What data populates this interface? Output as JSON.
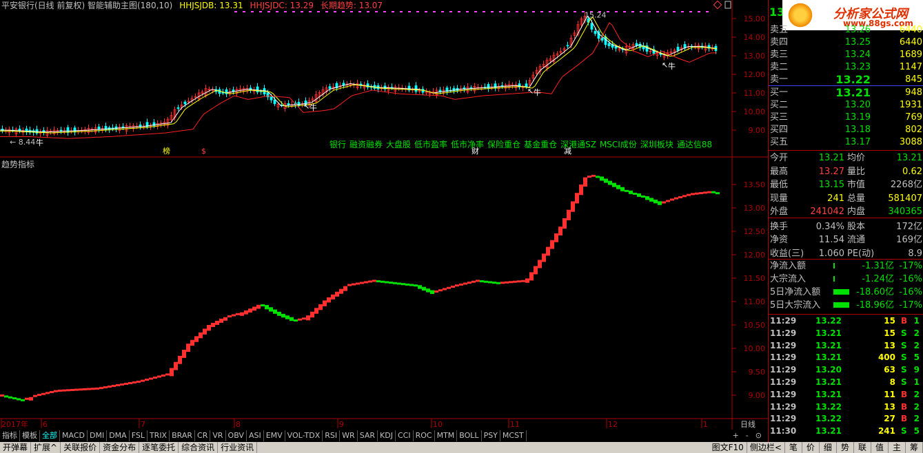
{
  "header": {
    "stock_title": "平安银行(日线 前复权) 智能辅助主图(180,10)",
    "hhjsjdb": "HHJSJDB: 13.31",
    "hhjsjdc": "HHJSJDC: 13.29",
    "long_trend": "长期趋势: 13.07",
    "high_label": "15.24",
    "low_label": "8.44"
  },
  "main_axis": [
    "15.00",
    "14.00",
    "13.00",
    "12.00",
    "11.00",
    "10.00",
    "9.00"
  ],
  "sub_axis": [
    "13.50",
    "13.00",
    "12.50",
    "12.00",
    "11.50",
    "11.00",
    "10.50",
    "10.00",
    "9.50",
    "9.00"
  ],
  "sub_title": "趋势指标",
  "tags": [
    "银行",
    "融资融券",
    "大盘股",
    "低市盈率",
    "低市净率",
    "保险重仓",
    "基金重仓",
    "深港通SZ",
    "MSCI成份",
    "深圳板块",
    "通达信88"
  ],
  "markers": {
    "bang": "榜",
    "dollar": "$",
    "cai": "财",
    "jian": "减",
    "niu": "牛"
  },
  "x_axis": [
    "2017年",
    "6",
    "7",
    "8",
    "9",
    "10",
    "11",
    "12",
    "1"
  ],
  "x_axis_label": "日线",
  "tabs": [
    "指标",
    "模板",
    "全部",
    "MACD",
    "DMI",
    "DMA",
    "FSL",
    "TRIX",
    "BRAR",
    "CR",
    "VR",
    "OBV",
    "ASI",
    "EMV",
    "VOL-TDX",
    "RSI",
    "WR",
    "SAR",
    "KDJ",
    "CCI",
    "ROC",
    "MTM",
    "BOLL",
    "PSY",
    "MCST"
  ],
  "tab_controls": [
    "+",
    "-",
    "⊙"
  ],
  "bottom_bar": [
    "开弹幕",
    "扩展^",
    "关联报价",
    "资金分布",
    "逐笔委托",
    "综合资讯",
    "行业资讯"
  ],
  "bottom_right": [
    "图文F10",
    "侧边栏<",
    "笔",
    "价",
    "细",
    "势",
    "联",
    "值",
    "主",
    "筹"
  ],
  "quote": {
    "code": "13",
    "logo_title": "分析家公式网",
    "logo_url": "www.88gs.com",
    "sell": [
      {
        "label": "卖五",
        "price": "13.26",
        "vol": "6440"
      },
      {
        "label": "卖四",
        "price": "13.25",
        "vol": "6440"
      },
      {
        "label": "卖三",
        "price": "13.24",
        "vol": "1689"
      },
      {
        "label": "卖二",
        "price": "13.23",
        "vol": "1147"
      },
      {
        "label": "卖一",
        "price": "13.22",
        "vol": "845"
      }
    ],
    "buy": [
      {
        "label": "买一",
        "price": "13.21",
        "vol": "948"
      },
      {
        "label": "买二",
        "price": "13.20",
        "vol": "1931"
      },
      {
        "label": "买三",
        "price": "13.19",
        "vol": "769"
      },
      {
        "label": "买四",
        "price": "13.18",
        "vol": "802"
      },
      {
        "label": "买五",
        "price": "13.17",
        "vol": "3088"
      }
    ],
    "stats": [
      {
        "l1": "今开",
        "v1": "13.21",
        "c1": "#00e000",
        "l2": "均价",
        "v2": "13.21",
        "c2": "#00e000"
      },
      {
        "l1": "最高",
        "v1": "13.27",
        "c1": "#ff4040",
        "l2": "量比",
        "v2": "0.62",
        "c2": "#ffff00"
      },
      {
        "l1": "最低",
        "v1": "13.15",
        "c1": "#00e000",
        "l2": "市值",
        "v2": "2268亿",
        "c2": "#c0c0c0"
      },
      {
        "l1": "现量",
        "v1": "241",
        "c1": "#ffff00",
        "l2": "总量",
        "v2": "581407",
        "c2": "#ffff00"
      },
      {
        "l1": "外盘",
        "v1": "241042",
        "c1": "#ff4040",
        "l2": "内盘",
        "v2": "340365",
        "c2": "#00e000"
      },
      {
        "l1": "换手",
        "v1": "0.34%",
        "c1": "#c0c0c0",
        "l2": "股本",
        "v2": "172亿",
        "c2": "#c0c0c0"
      },
      {
        "l1": "净资",
        "v1": "11.54",
        "c1": "#c0c0c0",
        "l2": "流通",
        "v2": "169亿",
        "c2": "#c0c0c0"
      },
      {
        "l1": "收益(三)",
        "v1": "1.060",
        "c1": "#c0c0c0",
        "l2": "PE(动)",
        "v2": "8.9",
        "c2": "#c0c0c0"
      }
    ],
    "flows": [
      {
        "label": "净流入额",
        "value": "-1.31亿",
        "pct": "-17%",
        "bar": 0.02
      },
      {
        "label": "大宗流入",
        "value": "-1.24亿",
        "pct": "-16%",
        "bar": 0.02
      },
      {
        "label": "5日净流入额",
        "value": "-18.60亿",
        "pct": "-16%",
        "bar": 0.9
      },
      {
        "label": "5日大宗流入",
        "value": "-18.96亿",
        "pct": "-17%",
        "bar": 0.9
      }
    ],
    "ticks": [
      {
        "t": "11:29",
        "p": "13.22",
        "v": "15",
        "d": "B",
        "n": "1"
      },
      {
        "t": "11:29",
        "p": "13.21",
        "v": "15",
        "d": "S",
        "n": "2"
      },
      {
        "t": "11:29",
        "p": "13.21",
        "v": "13",
        "d": "S",
        "n": "2"
      },
      {
        "t": "11:29",
        "p": "13.21",
        "v": "400",
        "d": "S",
        "n": "5"
      },
      {
        "t": "11:29",
        "p": "13.20",
        "v": "63",
        "d": "S",
        "n": "9"
      },
      {
        "t": "11:29",
        "p": "13.21",
        "v": "8",
        "d": "S",
        "n": "1"
      },
      {
        "t": "11:29",
        "p": "13.21",
        "v": "11",
        "d": "B",
        "n": "2"
      },
      {
        "t": "11:29",
        "p": "13.22",
        "v": "13",
        "d": "B",
        "n": "2"
      },
      {
        "t": "11:29",
        "p": "13.22",
        "v": "27",
        "d": "B",
        "n": "2"
      },
      {
        "t": "11:30",
        "p": "13.21",
        "v": "241",
        "d": "S",
        "n": "5"
      }
    ]
  },
  "colors": {
    "up": "#ff3030",
    "down": "#00ffff",
    "green": "#00e000",
    "grid": "#b00000",
    "ma_white": "#ffffff",
    "ma_yellow": "#ffff00",
    "ma_red": "#ff2020"
  }
}
